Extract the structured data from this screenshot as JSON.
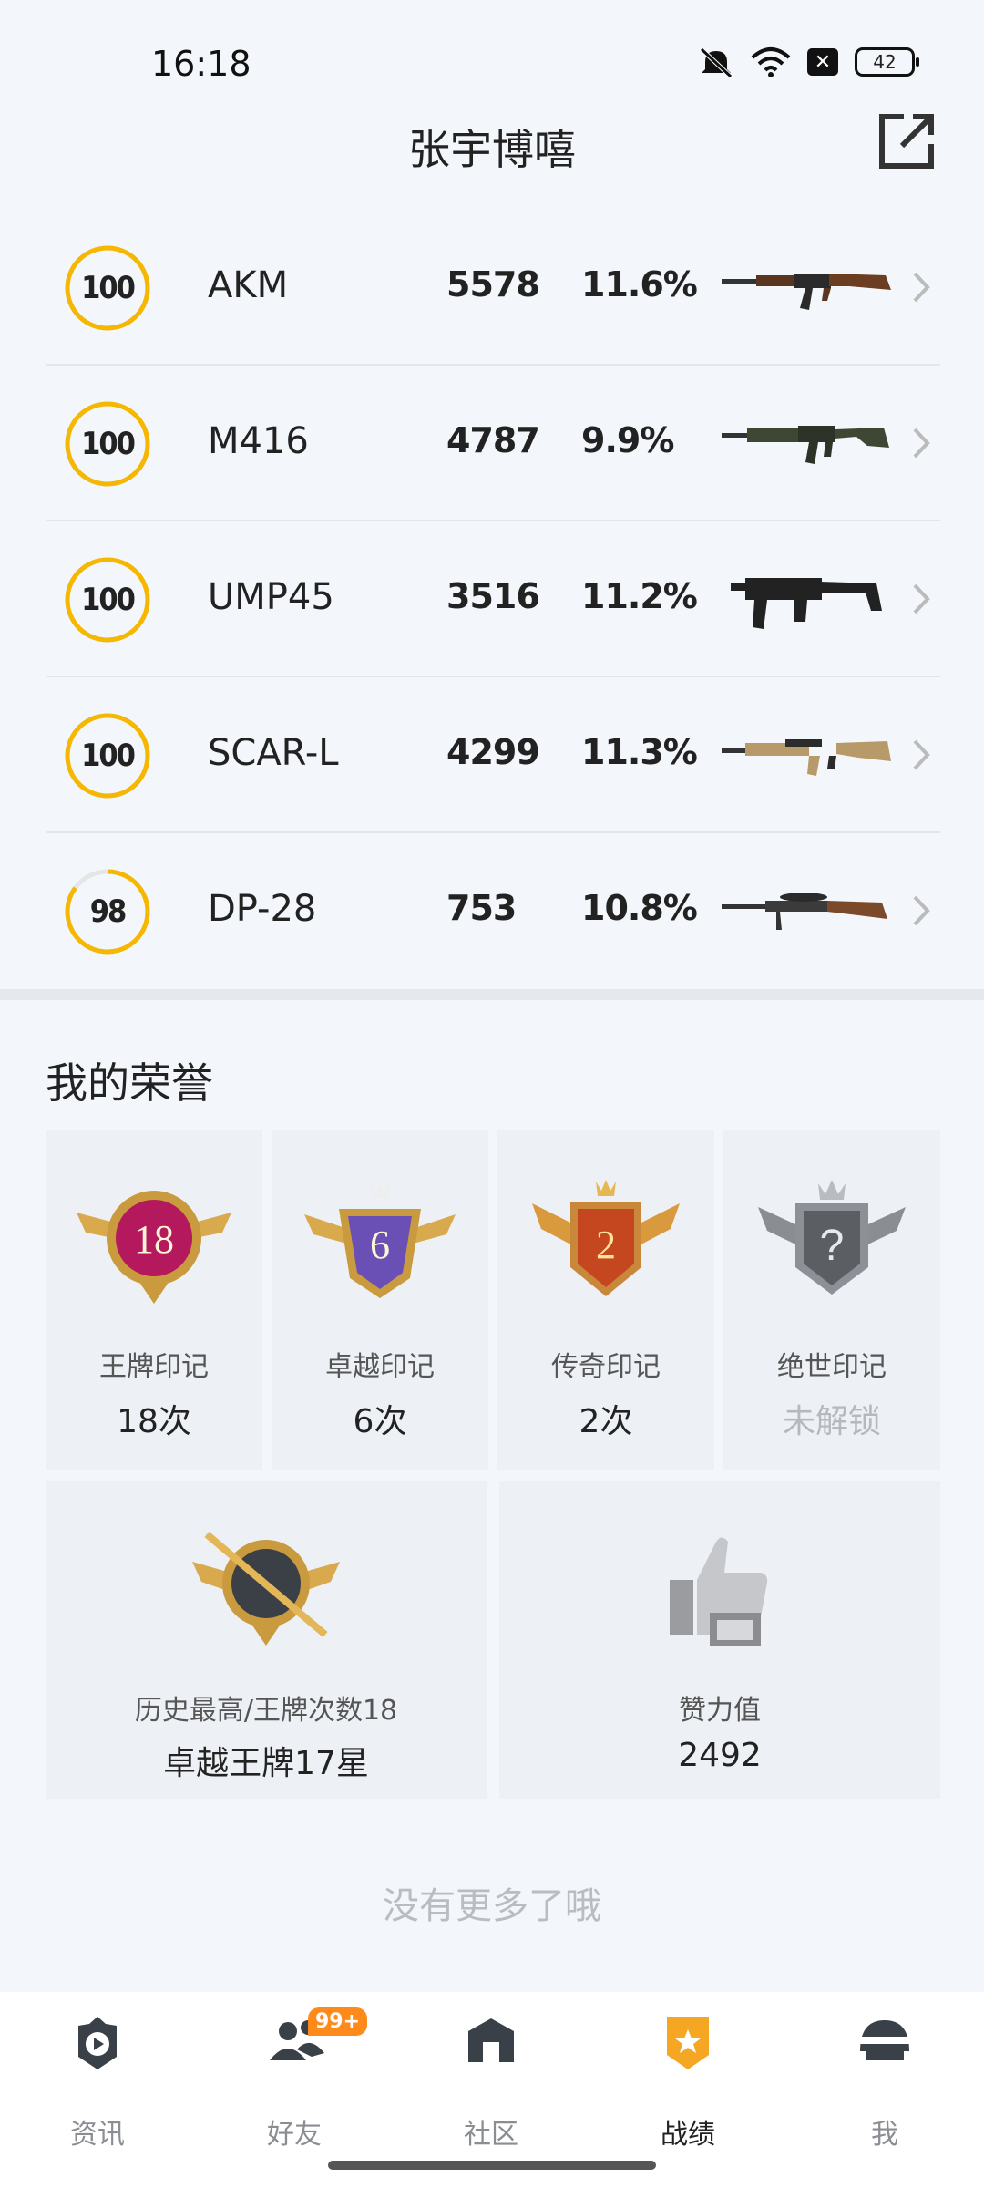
{
  "status_bar": {
    "time": "16:18",
    "battery": "42"
  },
  "header": {
    "title": "张宇博嘻"
  },
  "weapons": [
    {
      "level": "100",
      "progress": 1.0,
      "name": "AKM",
      "kills": "5578",
      "pct": "11.6%"
    },
    {
      "level": "100",
      "progress": 1.0,
      "name": "M416",
      "kills": "4787",
      "pct": "9.9%"
    },
    {
      "level": "100",
      "progress": 1.0,
      "name": "UMP45",
      "kills": "3516",
      "pct": "11.2%"
    },
    {
      "level": "100",
      "progress": 1.0,
      "name": "SCAR-L",
      "kills": "4299",
      "pct": "11.3%"
    },
    {
      "level": "98",
      "progress": 0.85,
      "name": "DP-28",
      "kills": "753",
      "pct": "10.8%"
    }
  ],
  "honors": {
    "title": "我的荣誉",
    "medals": [
      {
        "badge": "18",
        "label": "王牌印记",
        "count": "18次"
      },
      {
        "badge": "6",
        "label": "卓越印记",
        "count": "6次"
      },
      {
        "badge": "2",
        "label": "传奇印记",
        "count": "2次"
      },
      {
        "badge": "?",
        "label": "绝世印记",
        "count": "未解锁"
      }
    ],
    "history": {
      "label": "历史最高/王牌次数18",
      "value": "卓越王牌17星"
    },
    "likes": {
      "label": "赞力值",
      "value": "2492"
    }
  },
  "no_more": "没有更多了哦",
  "nav": {
    "items": [
      "资讯",
      "好友",
      "社区",
      "战绩",
      "我"
    ],
    "friends_badge": "99+",
    "active": "战绩"
  },
  "colors": {
    "ring": "#f5b700",
    "accent_nav": "#f5a623"
  }
}
